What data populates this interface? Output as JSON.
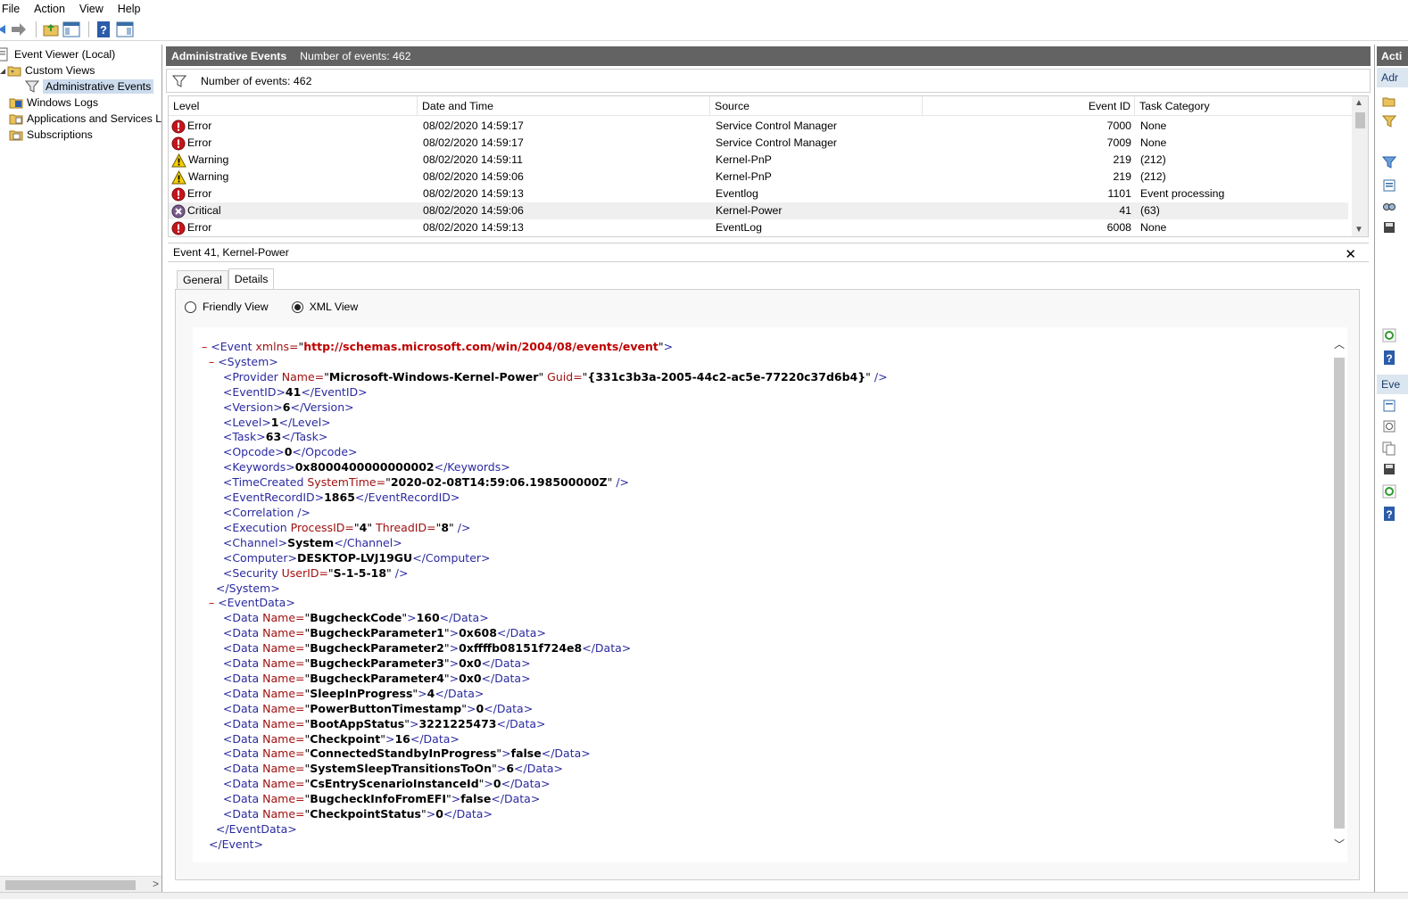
{
  "menu": [
    "File",
    "Action",
    "View",
    "Help"
  ],
  "tree": {
    "root": "Event Viewer (Local)",
    "custom_views": "Custom Views",
    "administrative_events": "Administrative Events",
    "windows_logs": "Windows Logs",
    "apps_services": "Applications and Services Lo",
    "subscriptions": "Subscriptions"
  },
  "header": {
    "title": "Administrative Events",
    "count": "Number of events: 462"
  },
  "filter": {
    "text": "Number of events: 462"
  },
  "columns": [
    "Level",
    "Date and Time",
    "Source",
    "Event ID",
    "Task Category"
  ],
  "events": [
    {
      "level": "Error",
      "icon": "error",
      "datetime": "08/02/2020 14:59:17",
      "source": "Service Control Manager",
      "id": "7000",
      "category": "None"
    },
    {
      "level": "Error",
      "icon": "error",
      "datetime": "08/02/2020 14:59:17",
      "source": "Service Control Manager",
      "id": "7009",
      "category": "None"
    },
    {
      "level": "Warning",
      "icon": "warning",
      "datetime": "08/02/2020 14:59:11",
      "source": "Kernel-PnP",
      "id": "219",
      "category": "(212)"
    },
    {
      "level": "Warning",
      "icon": "warning",
      "datetime": "08/02/2020 14:59:06",
      "source": "Kernel-PnP",
      "id": "219",
      "category": "(212)"
    },
    {
      "level": "Error",
      "icon": "error",
      "datetime": "08/02/2020 14:59:13",
      "source": "Eventlog",
      "id": "1101",
      "category": "Event processing"
    },
    {
      "level": "Critical",
      "icon": "critical",
      "datetime": "08/02/2020 14:59:06",
      "source": "Kernel-Power",
      "id": "41",
      "category": "(63)",
      "selected": true
    },
    {
      "level": "Error",
      "icon": "error",
      "datetime": "08/02/2020 14:59:13",
      "source": "EventLog",
      "id": "6008",
      "category": "None"
    }
  ],
  "detail": {
    "title": "Event 41, Kernel-Power",
    "close": "✕",
    "tabs": [
      "General",
      "Details"
    ],
    "radio_friendly": "Friendly View",
    "radio_xml": "XML View"
  },
  "xml": {
    "minus": "–",
    "ns_url": "http://schemas.microsoft.com/win/2004/08/events/event",
    "provider_name": "Microsoft-Windows-Kernel-Power",
    "provider_guid": "{331c3b3a-2005-44c2-ac5e-77220c37d6b4}",
    "event_id": "41",
    "version": "6",
    "level": "1",
    "task": "63",
    "opcode": "0",
    "keywords": "0x8000400000000002",
    "time_created": "2020-02-08T14:59:06.198500000Z",
    "record_id": "1865",
    "process_id": "4",
    "thread_id": "8",
    "channel": "System",
    "computer": "DESKTOP-LVJ19GU",
    "user_id": "S-1-5-18",
    "event_data": [
      {
        "name": "BugcheckCode",
        "value": "160"
      },
      {
        "name": "BugcheckParameter1",
        "value": "0x608"
      },
      {
        "name": "BugcheckParameter2",
        "value": "0xffffb08151f724e8"
      },
      {
        "name": "BugcheckParameter3",
        "value": "0x0"
      },
      {
        "name": "BugcheckParameter4",
        "value": "0x0"
      },
      {
        "name": "SleepInProgress",
        "value": "4"
      },
      {
        "name": "PowerButtonTimestamp",
        "value": "0"
      },
      {
        "name": "BootAppStatus",
        "value": "3221225473"
      },
      {
        "name": "Checkpoint",
        "value": "16"
      },
      {
        "name": "ConnectedStandbyInProgress",
        "value": "false"
      },
      {
        "name": "SystemSleepTransitionsToOn",
        "value": "6"
      },
      {
        "name": "CsEntryScenarioInstanceId",
        "value": "0"
      },
      {
        "name": "BugcheckInfoFromEFI",
        "value": "false"
      },
      {
        "name": "CheckpointStatus",
        "value": "0"
      }
    ]
  },
  "actions": {
    "header": "Acti",
    "sub1": "Adr",
    "sub2": "Eve"
  },
  "colors": {
    "header_bg": "#636363",
    "selection": "#ccdcee",
    "xml_tag": "#2a2aa0",
    "xml_attr": "#a01010",
    "xml_url": "#c00000"
  }
}
